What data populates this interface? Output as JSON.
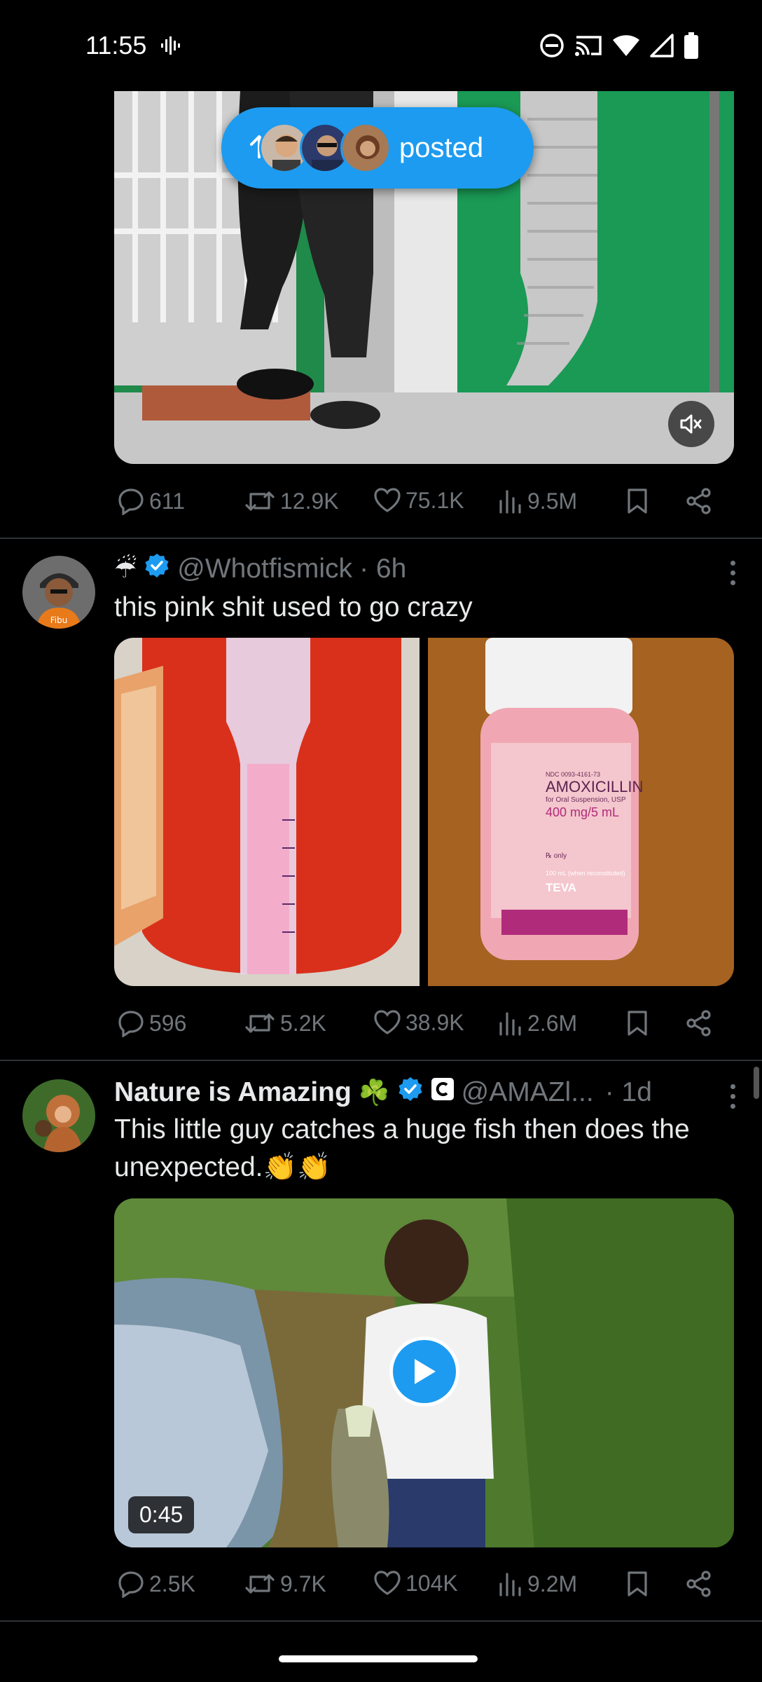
{
  "status_bar": {
    "time": "11:55",
    "icons": [
      "voicemail-icon",
      "dnd-icon",
      "cast-icon",
      "wifi-icon",
      "signal-icon",
      "battery-icon"
    ]
  },
  "posted_pill": {
    "label": "posted"
  },
  "tweets": [
    {
      "stats": {
        "replies": "611",
        "reposts": "12.9K",
        "likes": "75.1K",
        "views": "9.5M"
      }
    },
    {
      "emoji": "☔",
      "handle": "@Whotfismick",
      "time": "· 6h",
      "text": "this pink shit used to go crazy",
      "image_text": {
        "bottle_label": "AMOXICILLIN",
        "bottle_sub": "for Oral Suspension, USP",
        "bottle_dose": "400 mg/5 mL",
        "bottle_brand": "TEVA",
        "ndc": "NDC 0093-4161-73",
        "rx": "℞ only",
        "volume": "100 mL (when reconstituted)"
      },
      "stats": {
        "replies": "596",
        "reposts": "5.2K",
        "likes": "38.9K",
        "views": "2.6M"
      }
    },
    {
      "name": "Nature is Amazing",
      "name_emoji": "☘️",
      "handle": "@AMAZl...",
      "time": "· 1d",
      "text": "This little guy catches a huge fish then does the unexpected.👏👏",
      "duration": "0:45",
      "stats": {
        "replies": "2.5K",
        "reposts": "9.7K",
        "likes": "104K",
        "views": "9.2M"
      }
    }
  ],
  "colors": {
    "accent": "#1d9bf0",
    "muted": "#71767b",
    "background": "#000000",
    "divider": "#2f3336"
  }
}
